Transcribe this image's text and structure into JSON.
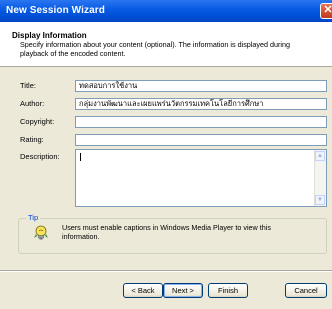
{
  "window": {
    "title": "New Session Wizard"
  },
  "header": {
    "title": "Display Information",
    "description": "Specify information about your content (optional). The information is displayed during playback of the encoded content."
  },
  "form": {
    "title_label": "Title:",
    "title_value": "ทดสอบการใช้งาน",
    "author_label": "Author:",
    "author_value": "กลุ่มงานพัฒนาและเผยแพร่นวัตกรรมเทคโนโลยีการศึกษา",
    "copyright_label": "Copyright:",
    "copyright_value": "",
    "rating_label": "Rating:",
    "rating_value": "",
    "description_label": "Description:",
    "description_value": ""
  },
  "tip": {
    "legend": "Tip",
    "text": "Users must enable captions in Windows Media Player to view this information."
  },
  "buttons": {
    "back": "< Back",
    "next": "Next >",
    "finish": "Finish",
    "cancel": "Cancel"
  },
  "icons": {
    "close": "close-icon",
    "tip": "lightbulb-icon"
  }
}
